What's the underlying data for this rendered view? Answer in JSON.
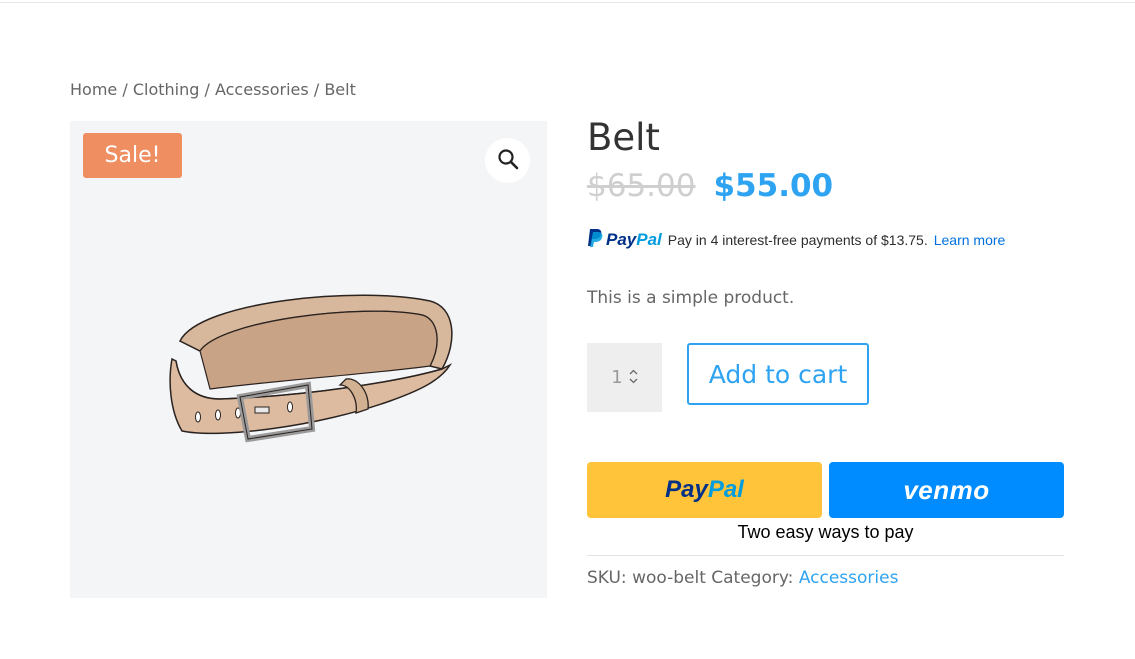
{
  "breadcrumb": {
    "items": [
      "Home",
      "Clothing",
      "Accessories"
    ],
    "current": "Belt",
    "separator": "/"
  },
  "gallery": {
    "badge": "Sale!",
    "zoom_icon": "magnifier-icon",
    "image_subject": "leather-belt"
  },
  "product": {
    "title": "Belt",
    "regular_price": "$65.00",
    "sale_price": "$55.00",
    "short_description": "This is a simple product."
  },
  "paypal_message": {
    "logo_pay": "Pay",
    "logo_pal": "Pal",
    "text": "Pay in 4 interest-free payments of $13.75.",
    "link": "Learn more"
  },
  "cart": {
    "quantity": "1",
    "add_to_cart_label": "Add to cart"
  },
  "payment_buttons": {
    "paypal_pay": "Pay",
    "paypal_pal": "Pal",
    "venmo": "venmo",
    "tagline": "Two easy ways to pay"
  },
  "meta": {
    "sku_label": "SKU:",
    "sku": "woo-belt",
    "category_label": "Category:",
    "category": "Accessories"
  },
  "colors": {
    "accent": "#2ea3f2",
    "sale_badge": "#ef8f61",
    "paypal_yellow": "#ffc439",
    "venmo_blue": "#008cff"
  }
}
